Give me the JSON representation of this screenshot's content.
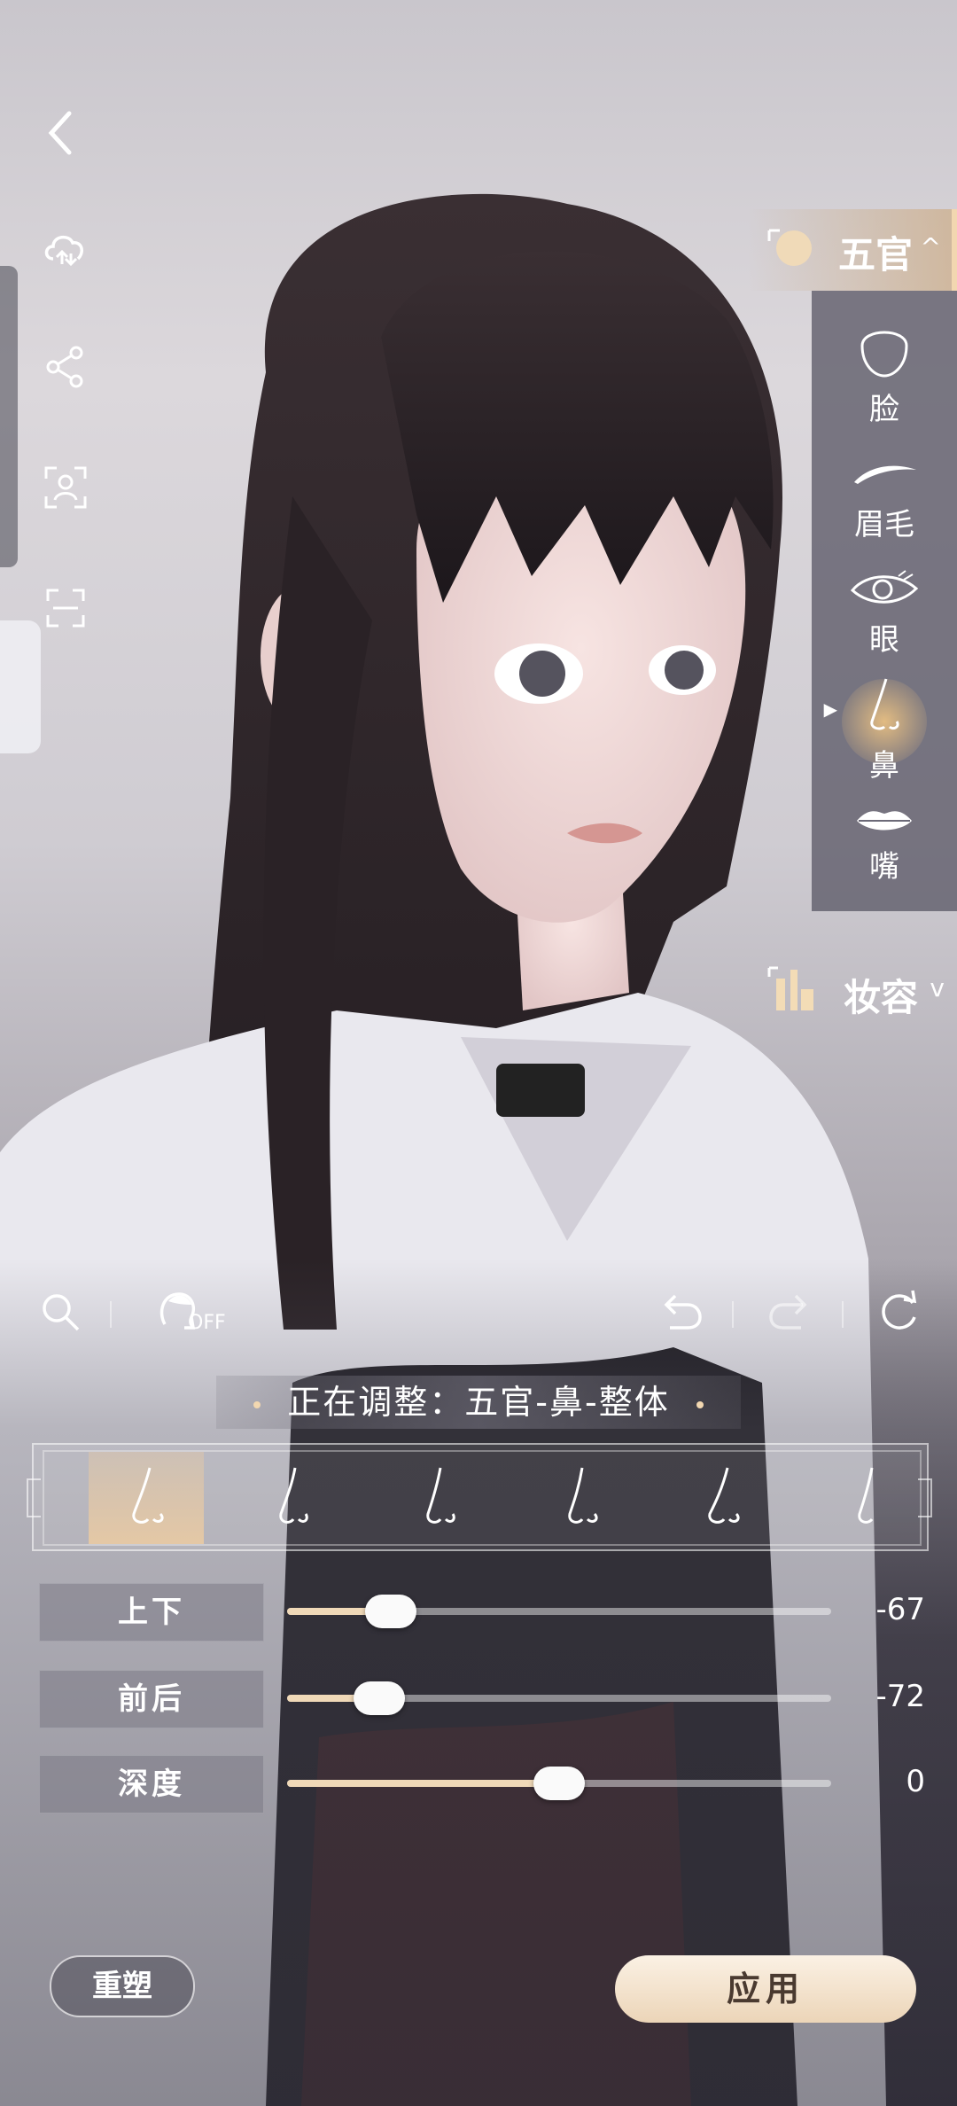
{
  "categories": {
    "features": {
      "label": "五官",
      "expanded": true
    },
    "makeup": {
      "label": "妆容",
      "expanded": false
    }
  },
  "features": [
    {
      "label": "脸",
      "icon": "face-outline-icon",
      "active": false
    },
    {
      "label": "眉毛",
      "icon": "eyebrow-icon",
      "active": false
    },
    {
      "label": "眼",
      "icon": "eye-icon",
      "active": false
    },
    {
      "label": "鼻",
      "icon": "nose-icon",
      "active": true
    },
    {
      "label": "嘴",
      "icon": "lips-icon",
      "active": false
    }
  ],
  "toolbar": {
    "off_label": "OFF"
  },
  "banner": {
    "text": "正在调整：五官-鼻-整体"
  },
  "sliders": [
    {
      "label": "上下",
      "value": "-67",
      "fraction": 0.19
    },
    {
      "label": "前后",
      "value": "-72",
      "fraction": 0.17
    },
    {
      "label": "深度",
      "value": "0",
      "fraction": 0.5
    }
  ],
  "buttons": {
    "reset": "重塑",
    "apply": "应用"
  },
  "colors": {
    "accent": "#f0d9b8",
    "apply_bg": "#f5e5d0"
  }
}
